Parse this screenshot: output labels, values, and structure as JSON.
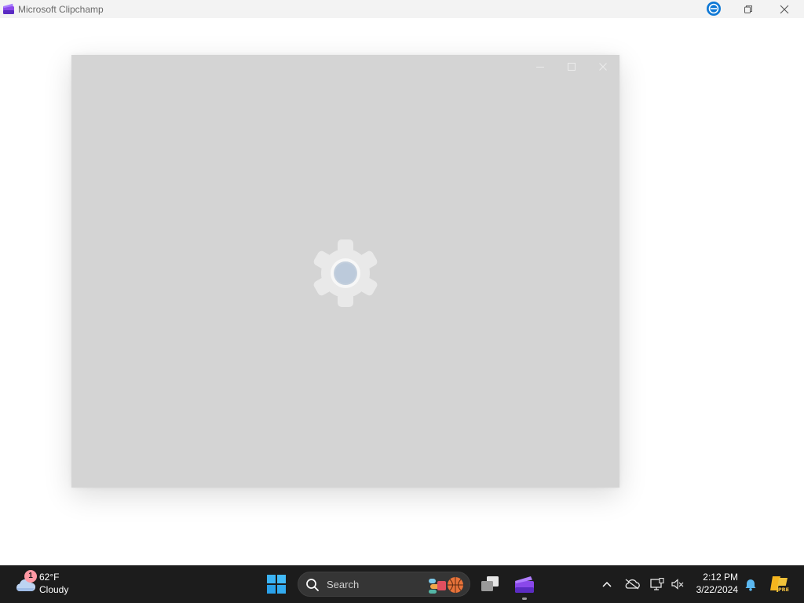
{
  "window": {
    "title": "Microsoft Clipchamp",
    "logo_icon": "clipchamp-logo",
    "controls": {
      "sync": "sync-status-icon",
      "restore": "restore-icon",
      "close": "close-icon"
    }
  },
  "loading_window": {
    "controls": {
      "minimize": "minimize-icon",
      "maximize": "maximize-icon",
      "close": "close-icon"
    },
    "spinner_icon": "gear-icon"
  },
  "taskbar": {
    "weather": {
      "temperature": "62°F",
      "condition": "Cloudy",
      "badge_count": "1",
      "icon": "cloud-icon"
    },
    "start_icon": "windows-logo-icon",
    "search": {
      "label": "Search",
      "icon": "search-icon"
    },
    "apps": [
      {
        "name": "Task View",
        "icon": "task-view-icon"
      },
      {
        "name": "Microsoft Clipchamp",
        "icon": "clipchamp-icon",
        "running": true
      }
    ],
    "tray": {
      "icons": [
        "chevron-up-icon",
        "onedrive-offline-icon",
        "display-icon",
        "volume-muted-icon",
        "bell-icon",
        "copilot-icon"
      ]
    },
    "clock": {
      "time": "2:12 PM",
      "date": "3/22/2024"
    }
  },
  "colors": {
    "taskbar": "#1c1c1c",
    "loading_surface": "#d4d4d4",
    "accent": "#0078d4",
    "clipchamp_purple": "#7b3fe4"
  }
}
